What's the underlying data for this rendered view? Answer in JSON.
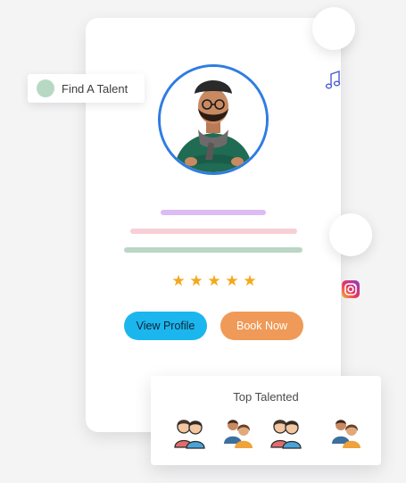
{
  "find_talent": {
    "label": "Find A Talent"
  },
  "profile": {
    "rating": 5,
    "stars": [
      "★",
      "★",
      "★",
      "★",
      "★"
    ],
    "avatar_icon": "person-portrait"
  },
  "buttons": {
    "view_profile": "View Profile",
    "book_now": "Book Now"
  },
  "top_talented": {
    "title": "Top Talented",
    "people_icons": [
      "duo-people-icon",
      "couple-people-icon",
      "duo-people-icon",
      "couple-people-icon"
    ]
  },
  "decor": {
    "music_icon": "music-note-icon",
    "social_icon": "instagram-icon"
  },
  "colors": {
    "accent_blue": "#2f7de1",
    "view_button": "#1cb6ef",
    "book_button": "#ef9a58",
    "star": "#f4a81a",
    "line_purple": "#dcbcf2",
    "line_pink": "#f8cfd6",
    "line_green": "#bcd6c6",
    "talent_dot": "#b7d9c4"
  }
}
